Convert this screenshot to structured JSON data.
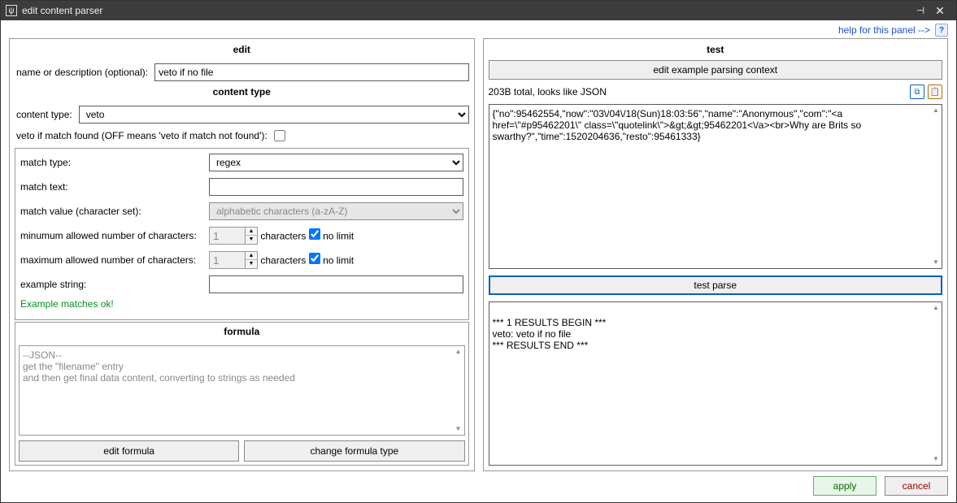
{
  "window": {
    "title": "edit content parser"
  },
  "header": {
    "help_link": "help for this panel -->"
  },
  "sections": {
    "edit": "edit",
    "content_type": "content type",
    "formula": "formula",
    "test": "test"
  },
  "edit": {
    "name_label": "name or description (optional):",
    "name_value": "veto if no file",
    "content_type_label": "content type:",
    "content_type_value": "veto",
    "veto_label": "veto if match found (OFF means 'veto if match not found'):",
    "veto_checked": false,
    "match_type_label": "match type:",
    "match_type_value": "regex",
    "match_text_label": "match text:",
    "match_text_value": "",
    "match_value_label": "match value (character set):",
    "match_value_value": "alphabetic characters (a-zA-Z)",
    "min_chars_label": "minumum allowed number of characters:",
    "min_chars_value": "1",
    "max_chars_label": "maximum allowed number of characters:",
    "max_chars_value": "1",
    "chars_suffix": "characters",
    "no_limit_label": "no limit",
    "min_no_limit": true,
    "max_no_limit": true,
    "example_label": "example string:",
    "example_value": "",
    "example_ok": "Example matches ok!",
    "formula_text": "--JSON--\nget the \"filename\" entry\nand then get final data content, converting to strings as needed",
    "edit_formula_btn": "edit formula",
    "change_formula_btn": "change formula type"
  },
  "test": {
    "edit_context_btn": "edit example parsing context",
    "info": "203B total, looks like JSON",
    "sample_text": "{\"no\":95462554,\"now\":\"03\\/04\\/18(Sun)18:03:56\",\"name\":\"Anonymous\",\"com\":\"<a href=\\\"#p95462201\\\" class=\\\"quotelink\\\">&gt;&gt;95462201<\\/a><br>Why are Brits so swarthy?\",\"time\":1520204636,\"resto\":95461333}",
    "test_parse_btn": "test parse",
    "results_text": "*** 1 RESULTS BEGIN ***\nveto: veto if no file\n*** RESULTS END ***"
  },
  "footer": {
    "apply": "apply",
    "cancel": "cancel"
  }
}
